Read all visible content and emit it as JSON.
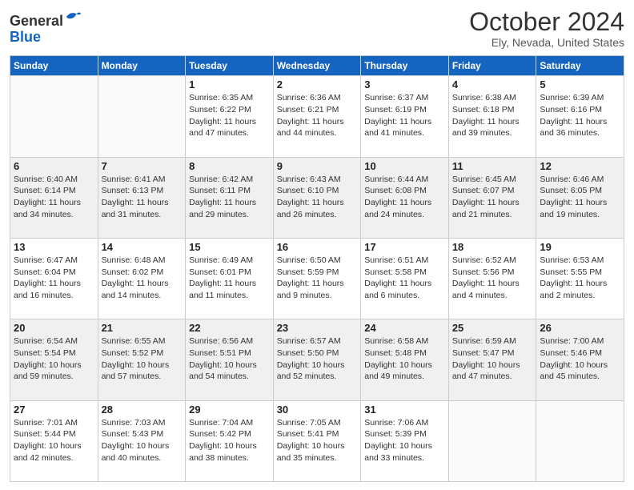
{
  "header": {
    "logo_line1": "General",
    "logo_line2": "Blue",
    "month": "October 2024",
    "location": "Ely, Nevada, United States"
  },
  "days_of_week": [
    "Sunday",
    "Monday",
    "Tuesday",
    "Wednesday",
    "Thursday",
    "Friday",
    "Saturday"
  ],
  "weeks": [
    [
      {
        "day": "",
        "info": ""
      },
      {
        "day": "",
        "info": ""
      },
      {
        "day": "1",
        "info": "Sunrise: 6:35 AM\nSunset: 6:22 PM\nDaylight: 11 hours and 47 minutes."
      },
      {
        "day": "2",
        "info": "Sunrise: 6:36 AM\nSunset: 6:21 PM\nDaylight: 11 hours and 44 minutes."
      },
      {
        "day": "3",
        "info": "Sunrise: 6:37 AM\nSunset: 6:19 PM\nDaylight: 11 hours and 41 minutes."
      },
      {
        "day": "4",
        "info": "Sunrise: 6:38 AM\nSunset: 6:18 PM\nDaylight: 11 hours and 39 minutes."
      },
      {
        "day": "5",
        "info": "Sunrise: 6:39 AM\nSunset: 6:16 PM\nDaylight: 11 hours and 36 minutes."
      }
    ],
    [
      {
        "day": "6",
        "info": "Sunrise: 6:40 AM\nSunset: 6:14 PM\nDaylight: 11 hours and 34 minutes."
      },
      {
        "day": "7",
        "info": "Sunrise: 6:41 AM\nSunset: 6:13 PM\nDaylight: 11 hours and 31 minutes."
      },
      {
        "day": "8",
        "info": "Sunrise: 6:42 AM\nSunset: 6:11 PM\nDaylight: 11 hours and 29 minutes."
      },
      {
        "day": "9",
        "info": "Sunrise: 6:43 AM\nSunset: 6:10 PM\nDaylight: 11 hours and 26 minutes."
      },
      {
        "day": "10",
        "info": "Sunrise: 6:44 AM\nSunset: 6:08 PM\nDaylight: 11 hours and 24 minutes."
      },
      {
        "day": "11",
        "info": "Sunrise: 6:45 AM\nSunset: 6:07 PM\nDaylight: 11 hours and 21 minutes."
      },
      {
        "day": "12",
        "info": "Sunrise: 6:46 AM\nSunset: 6:05 PM\nDaylight: 11 hours and 19 minutes."
      }
    ],
    [
      {
        "day": "13",
        "info": "Sunrise: 6:47 AM\nSunset: 6:04 PM\nDaylight: 11 hours and 16 minutes."
      },
      {
        "day": "14",
        "info": "Sunrise: 6:48 AM\nSunset: 6:02 PM\nDaylight: 11 hours and 14 minutes."
      },
      {
        "day": "15",
        "info": "Sunrise: 6:49 AM\nSunset: 6:01 PM\nDaylight: 11 hours and 11 minutes."
      },
      {
        "day": "16",
        "info": "Sunrise: 6:50 AM\nSunset: 5:59 PM\nDaylight: 11 hours and 9 minutes."
      },
      {
        "day": "17",
        "info": "Sunrise: 6:51 AM\nSunset: 5:58 PM\nDaylight: 11 hours and 6 minutes."
      },
      {
        "day": "18",
        "info": "Sunrise: 6:52 AM\nSunset: 5:56 PM\nDaylight: 11 hours and 4 minutes."
      },
      {
        "day": "19",
        "info": "Sunrise: 6:53 AM\nSunset: 5:55 PM\nDaylight: 11 hours and 2 minutes."
      }
    ],
    [
      {
        "day": "20",
        "info": "Sunrise: 6:54 AM\nSunset: 5:54 PM\nDaylight: 10 hours and 59 minutes."
      },
      {
        "day": "21",
        "info": "Sunrise: 6:55 AM\nSunset: 5:52 PM\nDaylight: 10 hours and 57 minutes."
      },
      {
        "day": "22",
        "info": "Sunrise: 6:56 AM\nSunset: 5:51 PM\nDaylight: 10 hours and 54 minutes."
      },
      {
        "day": "23",
        "info": "Sunrise: 6:57 AM\nSunset: 5:50 PM\nDaylight: 10 hours and 52 minutes."
      },
      {
        "day": "24",
        "info": "Sunrise: 6:58 AM\nSunset: 5:48 PM\nDaylight: 10 hours and 49 minutes."
      },
      {
        "day": "25",
        "info": "Sunrise: 6:59 AM\nSunset: 5:47 PM\nDaylight: 10 hours and 47 minutes."
      },
      {
        "day": "26",
        "info": "Sunrise: 7:00 AM\nSunset: 5:46 PM\nDaylight: 10 hours and 45 minutes."
      }
    ],
    [
      {
        "day": "27",
        "info": "Sunrise: 7:01 AM\nSunset: 5:44 PM\nDaylight: 10 hours and 42 minutes."
      },
      {
        "day": "28",
        "info": "Sunrise: 7:03 AM\nSunset: 5:43 PM\nDaylight: 10 hours and 40 minutes."
      },
      {
        "day": "29",
        "info": "Sunrise: 7:04 AM\nSunset: 5:42 PM\nDaylight: 10 hours and 38 minutes."
      },
      {
        "day": "30",
        "info": "Sunrise: 7:05 AM\nSunset: 5:41 PM\nDaylight: 10 hours and 35 minutes."
      },
      {
        "day": "31",
        "info": "Sunrise: 7:06 AM\nSunset: 5:39 PM\nDaylight: 10 hours and 33 minutes."
      },
      {
        "day": "",
        "info": ""
      },
      {
        "day": "",
        "info": ""
      }
    ]
  ]
}
